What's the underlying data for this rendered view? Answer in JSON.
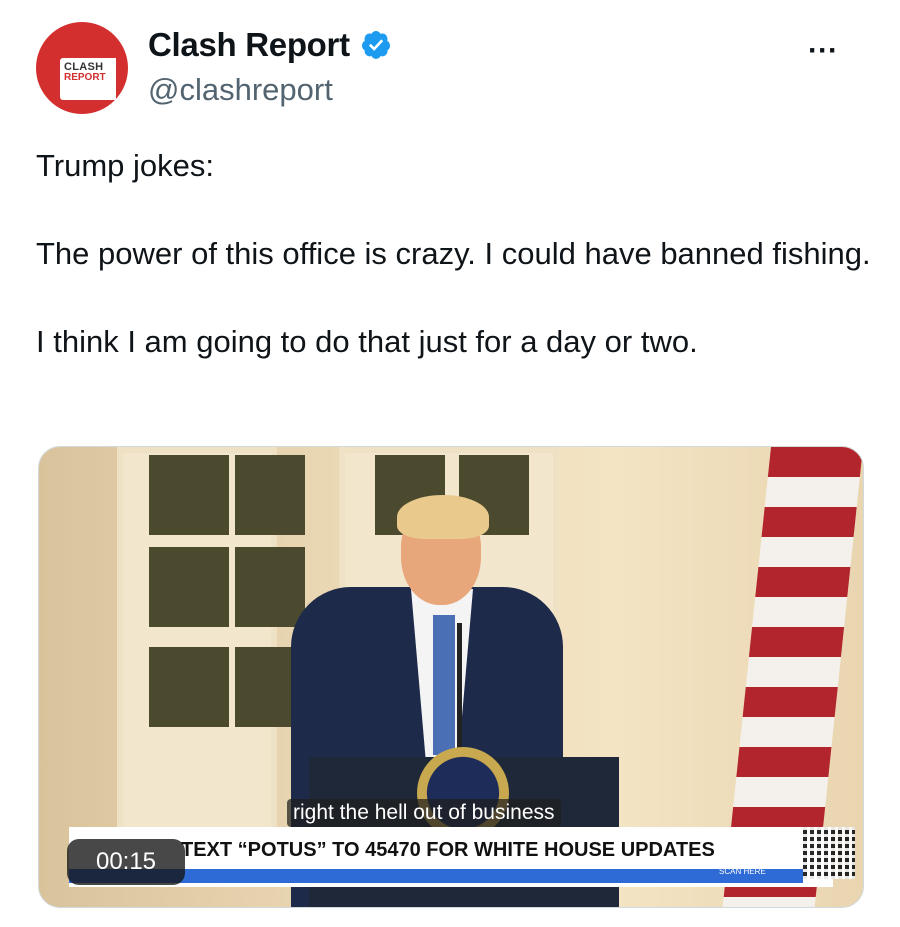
{
  "author": {
    "name": "Clash Report",
    "handle": "@clashreport",
    "avatar_text_top": "CLASH",
    "avatar_text_bottom": "REPORT"
  },
  "more_label": "···",
  "tweet": {
    "paragraphs": [
      "Trump jokes:",
      "The power of this office is crazy. I could have banned fishing.",
      "I think I am going to do that just for a day or two."
    ]
  },
  "video": {
    "caption": "right the hell out of business",
    "banner_text": "TEXT “POTUS” TO 45470 FOR WHITE HOUSE UPDATES",
    "scan_label": "SCAN HERE",
    "timestamp": "00:15"
  },
  "colors": {
    "verified": "#1d9bf0",
    "avatar_red": "#d32f2f",
    "banner_blue": "#2f6bd6"
  }
}
